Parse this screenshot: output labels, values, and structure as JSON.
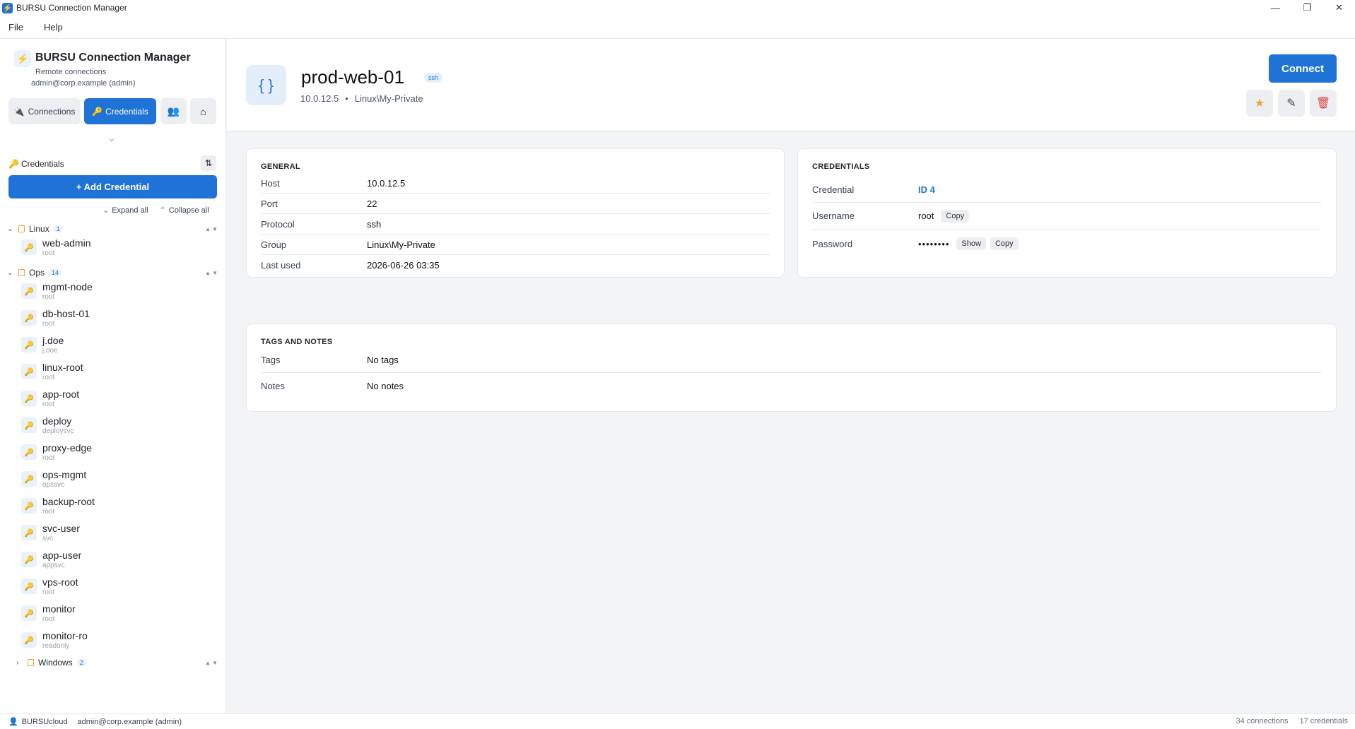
{
  "window": {
    "title": "BURSU Connection Manager",
    "controls": [
      "—",
      "❐",
      "✕"
    ]
  },
  "menu": {
    "items": [
      "File",
      "Help"
    ]
  },
  "sidebar": {
    "brand": {
      "name": "BURSU Connection Manager",
      "subtitle": "Remote connections",
      "user": "admin@corp.example (admin)"
    },
    "tabs": {
      "connections": "Connections",
      "credentials": "Credentials"
    },
    "section": {
      "label": "Credentials"
    },
    "add_button": "+ Add Credential",
    "expand_all": "Expand all",
    "collapse_all": "Collapse all",
    "groups": [
      {
        "name": "Linux",
        "count": "1",
        "expanded": true,
        "items": [
          {
            "name": "web-admin",
            "user": "root"
          }
        ]
      },
      {
        "name": "Ops",
        "count": "14",
        "expanded": true,
        "items": [
          {
            "name": "mgmt-node",
            "user": "root"
          },
          {
            "name": "db-host-01",
            "user": "root"
          },
          {
            "name": "j.doe",
            "user": "j.doe"
          },
          {
            "name": "linux-root",
            "user": "root"
          },
          {
            "name": "app-root",
            "user": "root"
          },
          {
            "name": "deploy",
            "user": "deploysvc"
          },
          {
            "name": "proxy-edge",
            "user": "root"
          },
          {
            "name": "ops-mgmt",
            "user": "opssvc"
          },
          {
            "name": "backup-root",
            "user": "root"
          },
          {
            "name": "svc-user",
            "user": "svc"
          },
          {
            "name": "app-user",
            "user": "appsvc"
          },
          {
            "name": "vps-root",
            "user": "root"
          },
          {
            "name": "monitor",
            "user": "root"
          },
          {
            "name": "monitor-ro",
            "user": "readonly"
          }
        ]
      },
      {
        "name": "Windows",
        "count": "2",
        "expanded": false,
        "items": []
      }
    ]
  },
  "header": {
    "title": "prod-web-01",
    "badge": "ssh",
    "host": "10.0.12.5",
    "separator": "•",
    "group": "Linux\\My-Private",
    "connect_label": "Connect"
  },
  "general": {
    "heading": "GENERAL",
    "rows": [
      {
        "key": "Host",
        "value": "10.0.12.5"
      },
      {
        "key": "Port",
        "value": "22"
      },
      {
        "key": "Protocol",
        "value": "ssh"
      },
      {
        "key": "Group",
        "value": "Linux\\My-Private"
      },
      {
        "key": "Last used",
        "value": "2026-06-26 03:35"
      }
    ]
  },
  "credentials": {
    "heading": "CREDENTIALS",
    "credential_label": "Credential",
    "credential_value": "ID 4",
    "username_label": "Username",
    "username_value": "root",
    "password_label": "Password",
    "password_value": "••••••••",
    "copy_label": "Copy",
    "show_label": "Show"
  },
  "tags_notes": {
    "heading": "TAGS AND NOTES",
    "tags_label": "Tags",
    "tags_value": "No tags",
    "notes_label": "Notes",
    "notes_value": "No notes"
  },
  "statusbar": {
    "server": "BURSUcloud",
    "user": "admin@corp.example (admin)",
    "connections": "34 connections",
    "credentials": "17 credentials"
  },
  "colors": {
    "accent": "#1f73d6",
    "star": "#f0a13b",
    "danger": "#d93b3b"
  }
}
